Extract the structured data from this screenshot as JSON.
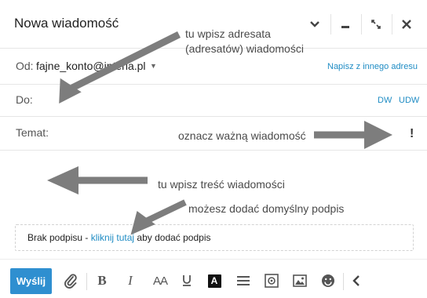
{
  "window": {
    "title": "Nowa wiadomość"
  },
  "header_buttons": [
    {
      "icon": "chevron-down-icon"
    },
    {
      "icon": "minimize-icon"
    },
    {
      "icon": "resize-icon"
    },
    {
      "icon": "close-icon"
    }
  ],
  "from": {
    "label": "Od:",
    "value": "fajne_konto@interia.pl",
    "alt_link": "Napisz z innego adresu"
  },
  "to": {
    "label": "Do:",
    "dw": "DW",
    "udw": "UDW"
  },
  "subject": {
    "label": "Temat:",
    "important_mark": "!"
  },
  "signature": {
    "prefix": "Brak podpisu - ",
    "link": "kliknij tutaj",
    "suffix": " aby dodać podpis"
  },
  "toolbar": {
    "send_label": "Wyślij",
    "aa_label": "AA",
    "icons": [
      "paperclip-icon",
      "bold-icon",
      "italic-icon",
      "font-size-icon",
      "underline-icon",
      "text-color-icon",
      "align-icon",
      "special-chars-icon",
      "image-icon",
      "emoji-icon",
      "collapse-icon"
    ]
  },
  "annotations": {
    "to_hint_1": "tu wpisz adresata",
    "to_hint_2": "(adresatów) wiadomości",
    "important_hint": "oznacz ważną wiadomość",
    "body_hint": "tu wpisz treść wiadomości",
    "signature_hint": "możesz dodać domyślny podpis",
    "arrow_color": "#7d7d7d"
  }
}
